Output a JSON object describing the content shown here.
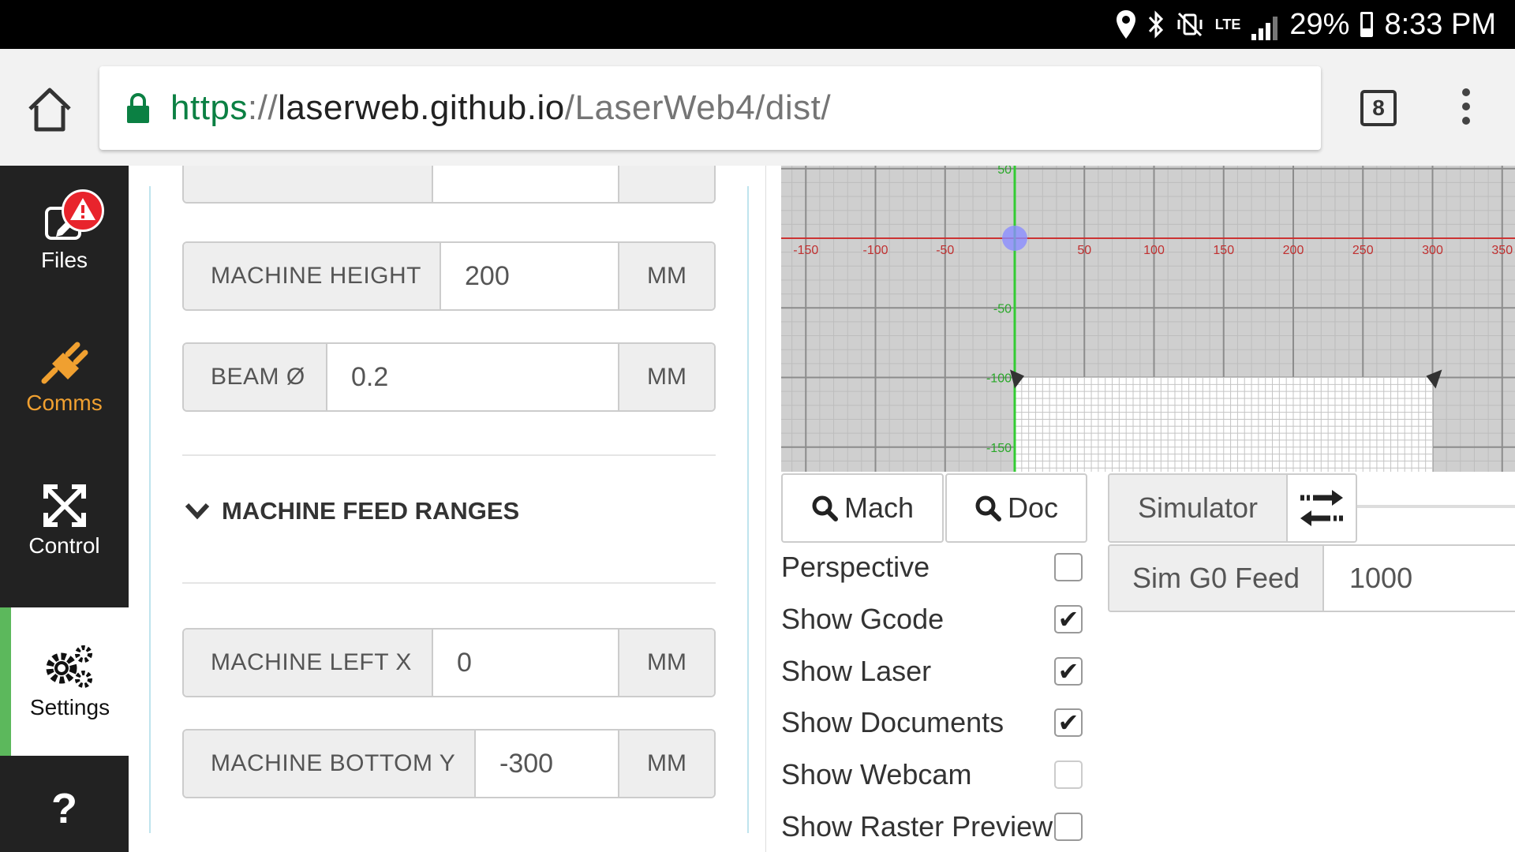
{
  "status_bar": {
    "battery": "29%",
    "battery_level": 0.29,
    "time": "8:33 PM",
    "network": "LTE",
    "icons": [
      "location-icon",
      "bluetooth-icon",
      "vibrate-mute-icon",
      "lte-icon",
      "signal-icon",
      "battery-icon"
    ]
  },
  "browser": {
    "url_scheme": "https",
    "url_sep": "://",
    "url_host": "laserweb.github.io",
    "url_path": "/LaserWeb4/dist/",
    "tab_count": "8",
    "colors": {
      "secure": "#0b8043"
    }
  },
  "sidebar": {
    "items": [
      {
        "label": "Files",
        "icon": "files-icon",
        "badge": "!"
      },
      {
        "label": "Comms",
        "icon": "plug-icon"
      },
      {
        "label": "Control",
        "icon": "arrows-move-icon"
      },
      {
        "label": "Settings",
        "icon": "gears-icon",
        "active": true
      },
      {
        "label": "",
        "icon": "help-icon",
        "glyph": "?"
      }
    ],
    "colors": {
      "active_accent": "#5cb85c",
      "comms": "#f0a030",
      "badge": "#e8242c"
    }
  },
  "settings": {
    "fields": [
      {
        "label": "MACHINE HEIGHT",
        "value": "200",
        "unit": "MM"
      },
      {
        "label": "BEAM Ø",
        "value": "0.2",
        "unit": "MM"
      },
      {
        "label": "MACHINE LEFT X",
        "value": "0",
        "unit": "MM"
      },
      {
        "label": "MACHINE BOTTOM Y",
        "value": "-300",
        "unit": "MM"
      }
    ],
    "section_title": "MACHINE FEED RANGES"
  },
  "workspace": {
    "x_ticks": [
      "-150",
      "-100",
      "-50",
      "50",
      "100",
      "150",
      "200",
      "250",
      "300",
      "350"
    ],
    "y_ticks": [
      "50",
      "-50",
      "-100",
      "-150"
    ],
    "colors": {
      "x_axis": "#cc3333",
      "y_axis": "#33cc33",
      "origin": "#8a8cff"
    }
  },
  "view_buttons": {
    "mach": "Mach",
    "doc": "Doc"
  },
  "options": [
    {
      "label": "Perspective",
      "checked": false
    },
    {
      "label": "Show Gcode",
      "checked": true
    },
    {
      "label": "Show Laser",
      "checked": true
    },
    {
      "label": "Show Documents",
      "checked": true
    },
    {
      "label": "Show Webcam",
      "checked": false
    },
    {
      "label": "Show Raster Preview",
      "checked": false
    }
  ],
  "simulator": {
    "label": "Simulator",
    "feed_label": "Sim G0 Feed",
    "feed_value": "1000"
  }
}
